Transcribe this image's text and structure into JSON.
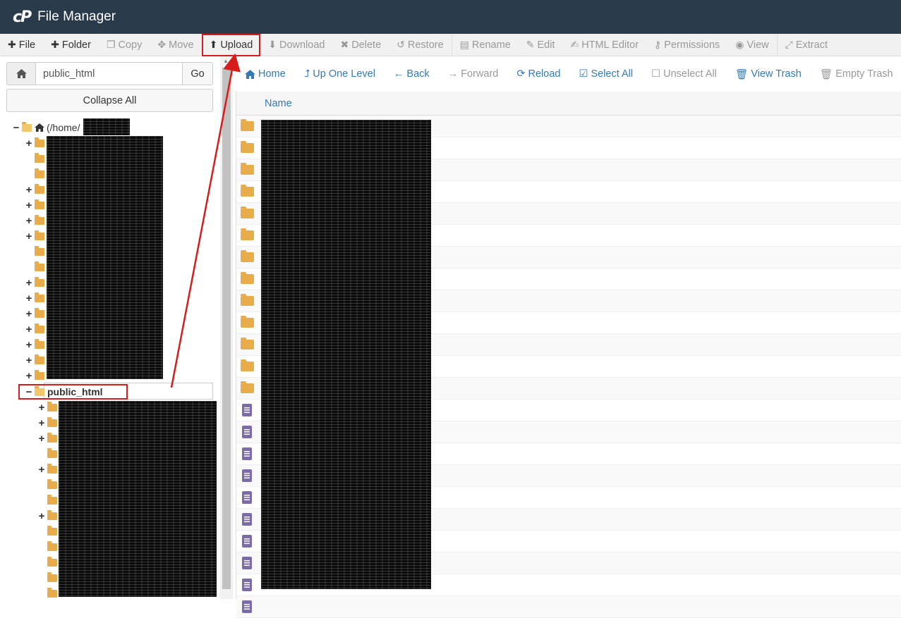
{
  "header": {
    "logo": "cP",
    "title": "File Manager"
  },
  "toolbar": {
    "file": "File",
    "folder": "Folder",
    "copy": "Copy",
    "move": "Move",
    "upload": "Upload",
    "download": "Download",
    "delete": "Delete",
    "restore": "Restore",
    "rename": "Rename",
    "edit": "Edit",
    "html_editor": "HTML Editor",
    "permissions": "Permissions",
    "view": "View",
    "extract": "Extract"
  },
  "left": {
    "path_value": "public_html",
    "go_label": "Go",
    "collapse_label": "Collapse All",
    "root_label": "(/home/",
    "public_html_label": "public_html"
  },
  "nav": {
    "home": "Home",
    "up": "Up One Level",
    "back": "Back",
    "forward": "Forward",
    "reload": "Reload",
    "select_all": "Select All",
    "unselect_all": "Unselect All",
    "view_trash": "View Trash",
    "empty_trash": "Empty Trash"
  },
  "table": {
    "name_header": "Name",
    "rows": [
      "folder",
      "folder",
      "folder",
      "folder",
      "folder",
      "folder",
      "folder",
      "folder",
      "folder",
      "folder",
      "folder",
      "folder",
      "folder",
      "file",
      "file",
      "file",
      "file",
      "file",
      "file",
      "file",
      "file",
      "file",
      "file"
    ]
  },
  "colors": {
    "header_bg": "#293a4a",
    "link": "#337ab7",
    "folder": "#e8ac4a",
    "file": "#7d6aa8",
    "annotation": "#d71c1c"
  }
}
